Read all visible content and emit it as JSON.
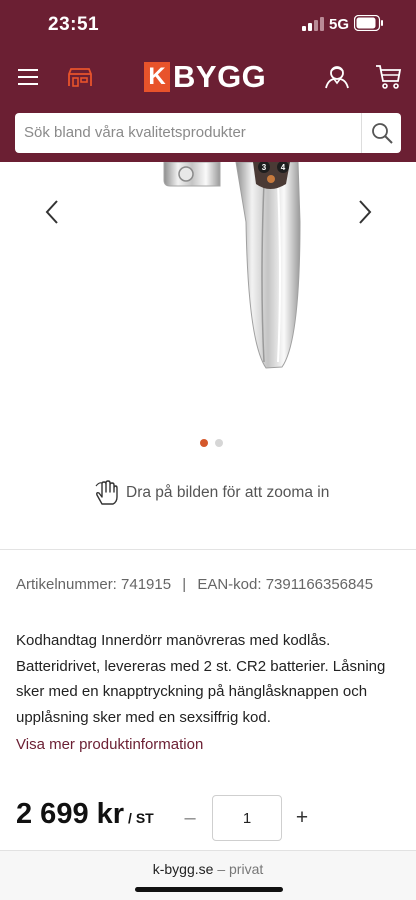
{
  "status_bar": {
    "time": "23:51",
    "network": "5G"
  },
  "header": {
    "logo_k": "K",
    "logo_text": "BYGG",
    "search_placeholder": "Sök bland våra kvalitetsprodukter",
    "icons": [
      "menu-icon",
      "store-icon",
      "account-icon",
      "cart-icon",
      "search-icon"
    ]
  },
  "gallery": {
    "zoom_hint": "Dra på bilden för att zooma in",
    "active_slide": 1,
    "slide_count": 2,
    "keypad_digits": [
      "3",
      "4"
    ]
  },
  "product": {
    "article_label": "Artikelnummer:",
    "article_number": "741915",
    "separator": "|",
    "ean_label": "EAN-kod:",
    "ean": "7391166356845",
    "description": "Kodhandtag Innerdörr manövreras med kodlås. Batteridrivet, levereras med 2 st. CR2 batterier. Låsning sker med en knapptryckning på hänglåsknappen och upplåsning sker med en sexsiffrig kod.",
    "more_info": "Visa mer produktinformation",
    "price": "2 699 kr",
    "unit": "/ ST",
    "quantity": "1",
    "minus": "–",
    "plus": "+"
  },
  "browser_bar": {
    "domain": "k-bygg.se",
    "suffix": "– privat"
  },
  "colors": {
    "brand": "#6b1f33",
    "accent": "#e8532b",
    "active_dot": "#d4582b"
  }
}
